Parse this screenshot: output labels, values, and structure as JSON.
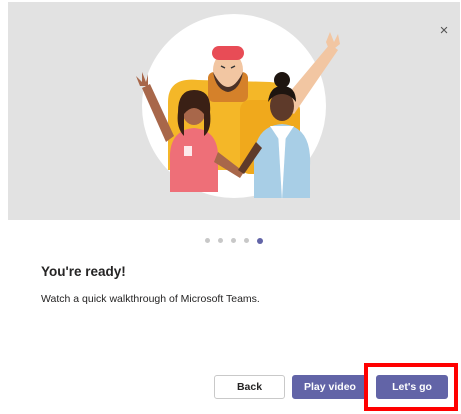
{
  "dialog": {
    "close_glyph": "×",
    "title": "You're ready!",
    "description": "Watch a quick walkthrough of Microsoft Teams.",
    "pager": {
      "total": 5,
      "active_index": 4
    },
    "buttons": {
      "back_label": "Back",
      "play_label": "Play video",
      "go_label": "Let's go"
    }
  },
  "colors": {
    "accent": "#6264a7",
    "hero_background": "#e2e2e2",
    "highlight": "#ff0000"
  },
  "icons": {
    "close": "close-icon",
    "illustration": "team-welcome-illustration"
  }
}
